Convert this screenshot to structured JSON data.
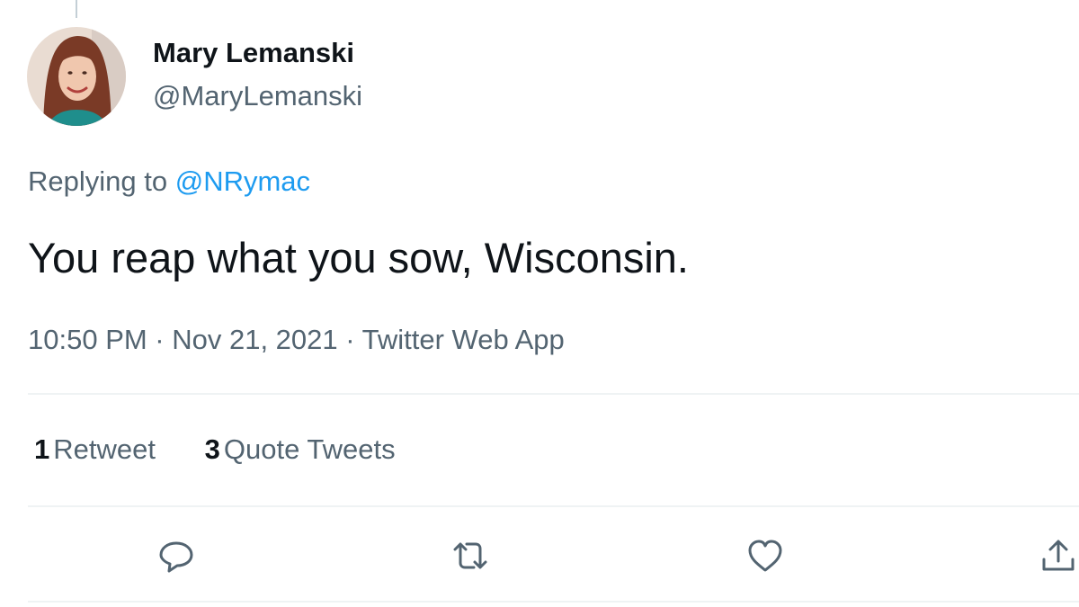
{
  "user": {
    "display_name": "Mary Lemanski",
    "handle": "@MaryLemanski"
  },
  "reply": {
    "prefix": "Replying to",
    "mention": "@NRymac"
  },
  "tweet": {
    "text": "You reap what you sow, Wisconsin.",
    "meta": "10:50 PM · Nov 21, 2021 · Twitter Web App"
  },
  "stats": {
    "retweets_count": "1",
    "retweets_label": "Retweet",
    "quotes_count": "3",
    "quotes_label": "Quote Tweets"
  },
  "actions": [
    "reply-icon",
    "retweet-icon",
    "like-icon",
    "share-icon"
  ],
  "colors": {
    "text": "#0f1419",
    "secondary": "#536471",
    "accent": "#1d9bf0",
    "divider": "#eff3f4"
  }
}
